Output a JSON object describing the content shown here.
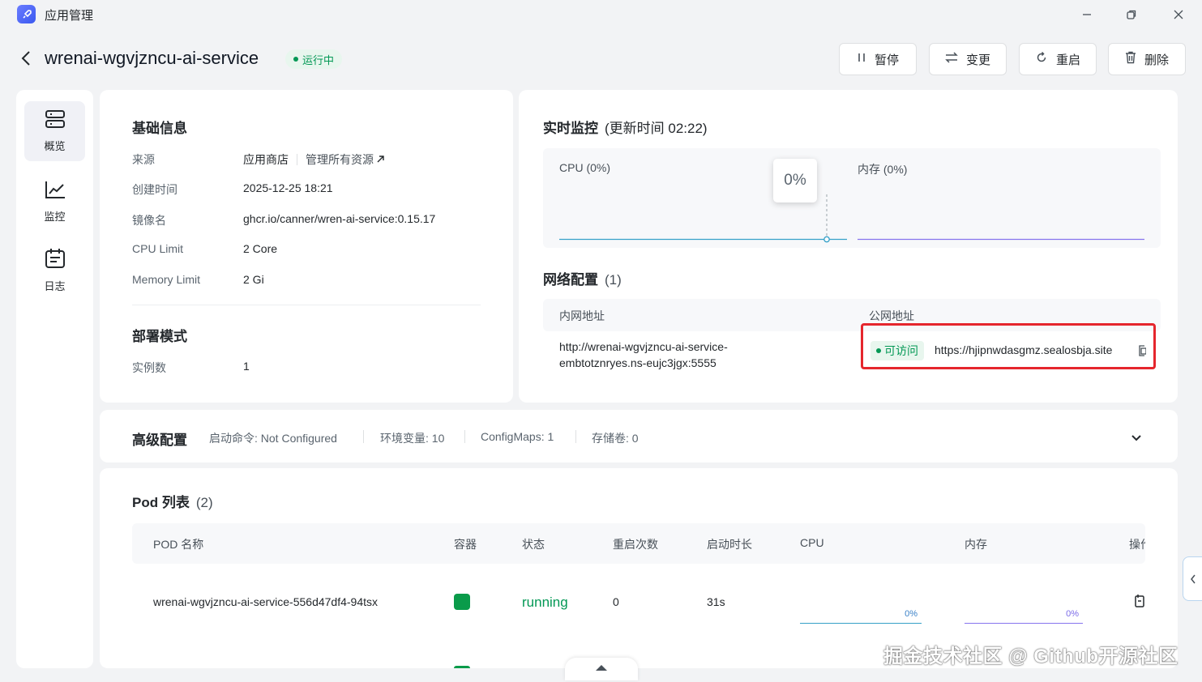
{
  "window": {
    "title": "应用管理",
    "icons": [
      "rocket-icon",
      "minimize-icon",
      "restore-icon",
      "close-icon"
    ]
  },
  "header": {
    "app_name": "wrenai-wgvjzncu-ai-service",
    "status": "运行中",
    "buttons": {
      "pause": "暂停",
      "change": "变更",
      "restart": "重启",
      "delete": "删除"
    }
  },
  "sidebar": {
    "items": [
      {
        "label": "概览"
      },
      {
        "label": "监控"
      },
      {
        "label": "日志"
      }
    ]
  },
  "basic_info": {
    "title": "基础信息",
    "source_label": "来源",
    "source_value": "应用商店",
    "source_link": "管理所有资源",
    "created_label": "创建时间",
    "created_value": "2025-12-25 18:21",
    "image_label": "镜像名",
    "image_value": "ghcr.io/canner/wren-ai-service:0.15.17",
    "cpu_label": "CPU Limit",
    "cpu_value": "2 Core",
    "mem_label": "Memory Limit",
    "mem_value": "2 Gi"
  },
  "deploy": {
    "title": "部署模式",
    "replicas_label": "实例数",
    "replicas_value": "1"
  },
  "monitor": {
    "title": "实时监控",
    "updated": "(更新时间  02:22)",
    "cpu_label": "CPU  (0%)",
    "mem_label": "内存  (0%)",
    "tooltip": "0%",
    "colors": {
      "cpu": "#36a1c8",
      "mem": "#8774ee"
    }
  },
  "network": {
    "title": "网络配置",
    "count": "(1)",
    "col_internal": "内网地址",
    "col_public": "公网地址",
    "internal_line1": "http://wrenai-wgvjzncu-ai-service-",
    "internal_line2": "embtotznryes.ns-eujc3jgx:5555",
    "badge": "可访问",
    "public_url": "https://hjipnwdasgmz.sealosbja.site"
  },
  "advanced": {
    "title": "高级配置",
    "startup": "启动命令: Not Configured",
    "env": "环境变量: 10",
    "configmaps": "ConfigMaps: 1",
    "storage": "存储卷: 0"
  },
  "pods": {
    "title": "Pod 列表",
    "count": "(2)",
    "headers": [
      "POD 名称",
      "容器",
      "状态",
      "重启次数",
      "启动时长",
      "CPU",
      "内存",
      "操作"
    ],
    "rows": [
      {
        "name": "wrenai-wgvjzncu-ai-service-556d47df4-94tsx",
        "status": "running",
        "restarts": "0",
        "uptime": "31s",
        "cpu": "0%",
        "mem": "0%"
      }
    ]
  },
  "watermark": "掘金技术社区 @ Github开源社区",
  "accent": {
    "green": "#039855",
    "highlight_red": "#e5262d",
    "container_green": "#0a9b4a"
  }
}
